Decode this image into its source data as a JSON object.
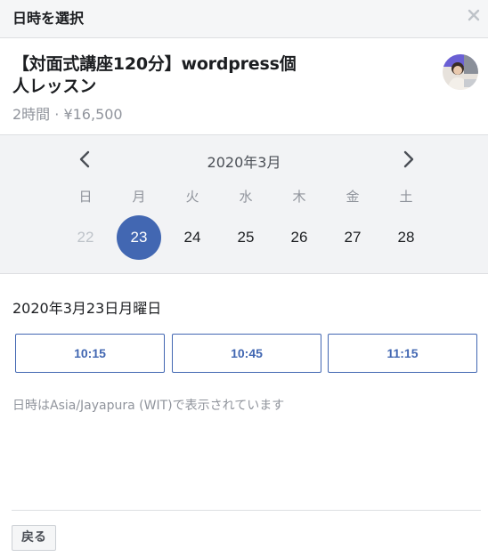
{
  "header": {
    "title": "日時を選択",
    "close_icon": "close-icon"
  },
  "service": {
    "title": "【対面式講座120分】wordpress個人レッスン",
    "meta": "2時間 · ¥16,500",
    "avatar_icon": "avatar"
  },
  "calendar": {
    "month": "2020年3月",
    "weekdays": [
      "日",
      "月",
      "火",
      "水",
      "木",
      "金",
      "土"
    ],
    "days": [
      {
        "label": "22",
        "state": "past"
      },
      {
        "label": "23",
        "state": "selected"
      },
      {
        "label": "24",
        "state": "available"
      },
      {
        "label": "25",
        "state": "available"
      },
      {
        "label": "26",
        "state": "available"
      },
      {
        "label": "27",
        "state": "available"
      },
      {
        "label": "28",
        "state": "available"
      }
    ],
    "accent_color": "#4267b2"
  },
  "selected_date": "2020年3月23日月曜日",
  "slots": [
    "10:15",
    "10:45",
    "11:15"
  ],
  "timezone_note": "日時はAsia/Jayapura (WIT)で表示されています",
  "footer": {
    "back_label": "戻る"
  }
}
